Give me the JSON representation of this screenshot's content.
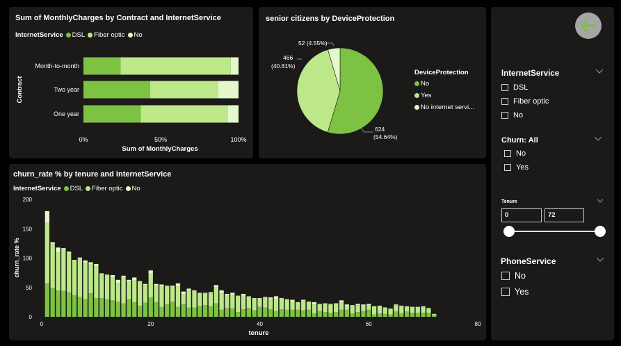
{
  "colors": {
    "dsl": "#7dc242",
    "fiber": "#bde88a",
    "no": "#e4f8cc",
    "panel": "#1b1a19"
  },
  "chart1": {
    "title": "Sum of MonthlyCharges by Contract and InternetService",
    "legend_title": "InternetService",
    "legend": [
      "DSL",
      "Fiber optic",
      "No"
    ],
    "ylabel": "Contract",
    "xlabel": "Sum of MonthlyCharges",
    "xticks": [
      "0%",
      "50%",
      "100%"
    ]
  },
  "chart2": {
    "title": "senior citizens by DeviceProtection",
    "legend_title": "DeviceProtection",
    "legend": [
      "No",
      "Yes",
      "No internet servi..."
    ],
    "labels": [
      {
        "value": "624",
        "pct": "(54.64%)"
      },
      {
        "value": "466",
        "pct": "(40.81%)"
      },
      {
        "value": "52 (4.55%)",
        "pct": ""
      }
    ]
  },
  "chart3": {
    "title": "churn_rate % by tenure and InternetService",
    "legend_title": "InternetService",
    "legend": [
      "DSL",
      "Fiber optic",
      "No"
    ],
    "ylabel": "churn_rate %",
    "xlabel": "tenure",
    "yticks": [
      "0",
      "50",
      "100",
      "150",
      "200"
    ],
    "xticks": [
      "0",
      "20",
      "40",
      "60",
      "80"
    ]
  },
  "back_icon": "arrow-left-icon",
  "slicers": {
    "internet": {
      "title": "InternetService",
      "options": [
        "DSL",
        "Fiber optic",
        "No"
      ]
    },
    "churn": {
      "title": "Churn: All",
      "options": [
        "No",
        "Yes"
      ]
    },
    "tenure": {
      "title": "Tenure",
      "min": "0",
      "max": "72"
    },
    "phone": {
      "title": "PhoneService",
      "options": [
        "No",
        "Yes"
      ]
    }
  },
  "chart_data": [
    {
      "type": "bar",
      "orientation": "horizontal-100%-stacked",
      "title": "Sum of MonthlyCharges by Contract and InternetService",
      "xlabel": "Sum of MonthlyCharges",
      "ylabel": "Contract",
      "categories": [
        "Month-to-month",
        "Two year",
        "One year"
      ],
      "series": [
        {
          "name": "DSL",
          "values": [
            24,
            43,
            37
          ]
        },
        {
          "name": "Fiber optic",
          "values": [
            71,
            44,
            56
          ]
        },
        {
          "name": "No",
          "values": [
            5,
            13,
            7
          ]
        }
      ],
      "xlim": [
        0,
        100
      ]
    },
    {
      "type": "pie",
      "title": "senior citizens by DeviceProtection",
      "labels": [
        "No",
        "Yes",
        "No internet servi..."
      ],
      "values": [
        624,
        466,
        52
      ],
      "percents": [
        54.64,
        40.81,
        4.55
      ]
    },
    {
      "type": "bar",
      "orientation": "vertical-stacked",
      "title": "churn_rate % by tenure and InternetService",
      "xlabel": "tenure",
      "ylabel": "churn_rate %",
      "ylim": [
        0,
        200
      ],
      "xlim": [
        0,
        80
      ],
      "x": [
        1,
        2,
        3,
        4,
        5,
        6,
        7,
        8,
        9,
        10,
        11,
        12,
        13,
        14,
        15,
        16,
        17,
        18,
        19,
        20,
        21,
        22,
        23,
        24,
        25,
        26,
        27,
        28,
        29,
        30,
        31,
        32,
        33,
        34,
        35,
        36,
        37,
        38,
        39,
        40,
        41,
        42,
        43,
        44,
        45,
        46,
        47,
        48,
        49,
        50,
        51,
        52,
        53,
        54,
        55,
        56,
        57,
        58,
        59,
        60,
        61,
        62,
        63,
        64,
        65,
        66,
        67,
        68,
        69,
        70,
        71,
        72
      ],
      "series": [
        {
          "name": "DSL",
          "values": [
            57,
            49,
            45,
            44,
            42,
            37,
            34,
            30,
            40,
            32,
            32,
            30,
            28,
            26,
            23,
            30,
            25,
            19,
            24,
            33,
            25,
            17,
            22,
            26,
            17,
            22,
            16,
            16,
            18,
            20,
            18,
            23,
            12,
            15,
            14,
            8,
            13,
            15,
            11,
            17,
            16,
            13,
            10,
            13,
            12,
            12,
            12,
            11,
            12,
            6,
            10,
            8,
            7,
            8,
            12,
            12,
            6,
            8,
            10,
            12,
            4,
            6,
            5,
            4,
            9,
            6,
            9,
            7,
            7,
            7,
            7,
            3
          ]
        },
        {
          "name": "Fiber optic",
          "values": [
            103,
            75,
            65,
            70,
            66,
            60,
            65,
            62,
            50,
            55,
            40,
            42,
            40,
            32,
            45,
            30,
            37,
            42,
            30,
            41,
            28,
            35,
            30,
            25,
            35,
            17,
            30,
            27,
            23,
            20,
            22,
            27,
            28,
            22,
            24,
            27,
            23,
            20,
            20,
            14,
            18,
            17,
            20,
            18,
            18,
            14,
            12,
            16,
            13,
            15,
            12,
            14,
            14,
            14,
            13,
            7,
            14,
            12,
            9,
            8,
            14,
            12,
            10,
            10,
            11,
            12,
            8,
            9,
            10,
            10,
            8,
            2
          ]
        },
        {
          "name": "No",
          "values": [
            20,
            3,
            8,
            3,
            3,
            0,
            2,
            4,
            3,
            3,
            2,
            0,
            3,
            5,
            2,
            3,
            5,
            0,
            2,
            5,
            3,
            3,
            1,
            2,
            5,
            4,
            2,
            2,
            0,
            1,
            2,
            4,
            5,
            2,
            3,
            1,
            3,
            0,
            1,
            1,
            0,
            3,
            5,
            1,
            0,
            3,
            1,
            2,
            1,
            4,
            0,
            1,
            1,
            1,
            3,
            2,
            0,
            2,
            2,
            2,
            0,
            1,
            1,
            0,
            1,
            1,
            1,
            1,
            0,
            1,
            0,
            0
          ]
        }
      ]
    }
  ]
}
